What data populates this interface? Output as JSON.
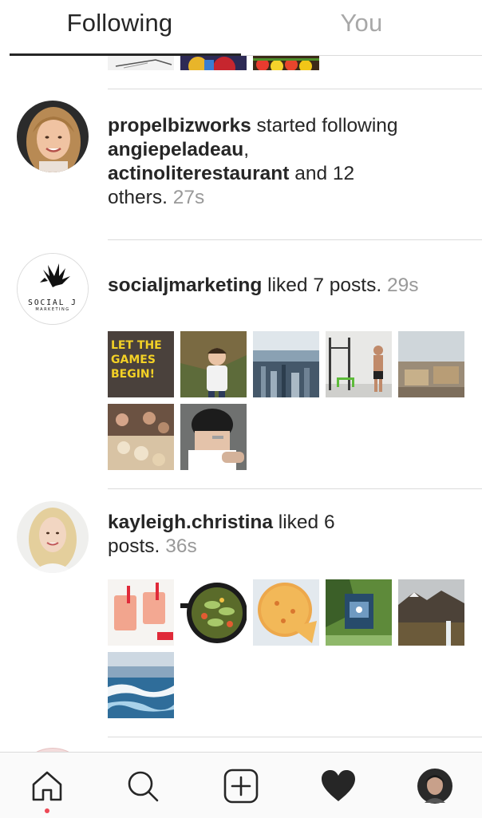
{
  "tabs": {
    "following": "Following",
    "you": "You"
  },
  "activities": [
    {
      "username": "propelbizworks",
      "action": "started following",
      "targets": [
        "angiepeladeau",
        "actinoliterestaurant"
      ],
      "connector": "and 12",
      "tail": "others.",
      "time": "27s"
    },
    {
      "username": "socialjmarketing",
      "action": "liked 7 posts.",
      "time": "29s",
      "logo_text": "SOCIAL J",
      "logo_subtext": "MARKETING",
      "thumb_overlay_text": [
        "LET THE",
        "GAMES",
        "BEGIN!"
      ],
      "post_count": 7
    },
    {
      "username": "kayleigh.christina",
      "action": "liked 6",
      "action_tail": "posts.",
      "time": "36s",
      "post_count": 6
    }
  ],
  "nav": {
    "items": [
      "home-icon",
      "search-icon",
      "new-post-icon",
      "activity-heart-icon",
      "profile-avatar"
    ],
    "active": "home-icon",
    "notification_dot_color": "#ed4956"
  },
  "colors": {
    "text": "#262626",
    "muted": "#999999",
    "divider": "#dbdbdb",
    "inactive_tab": "#a8a8a8"
  }
}
